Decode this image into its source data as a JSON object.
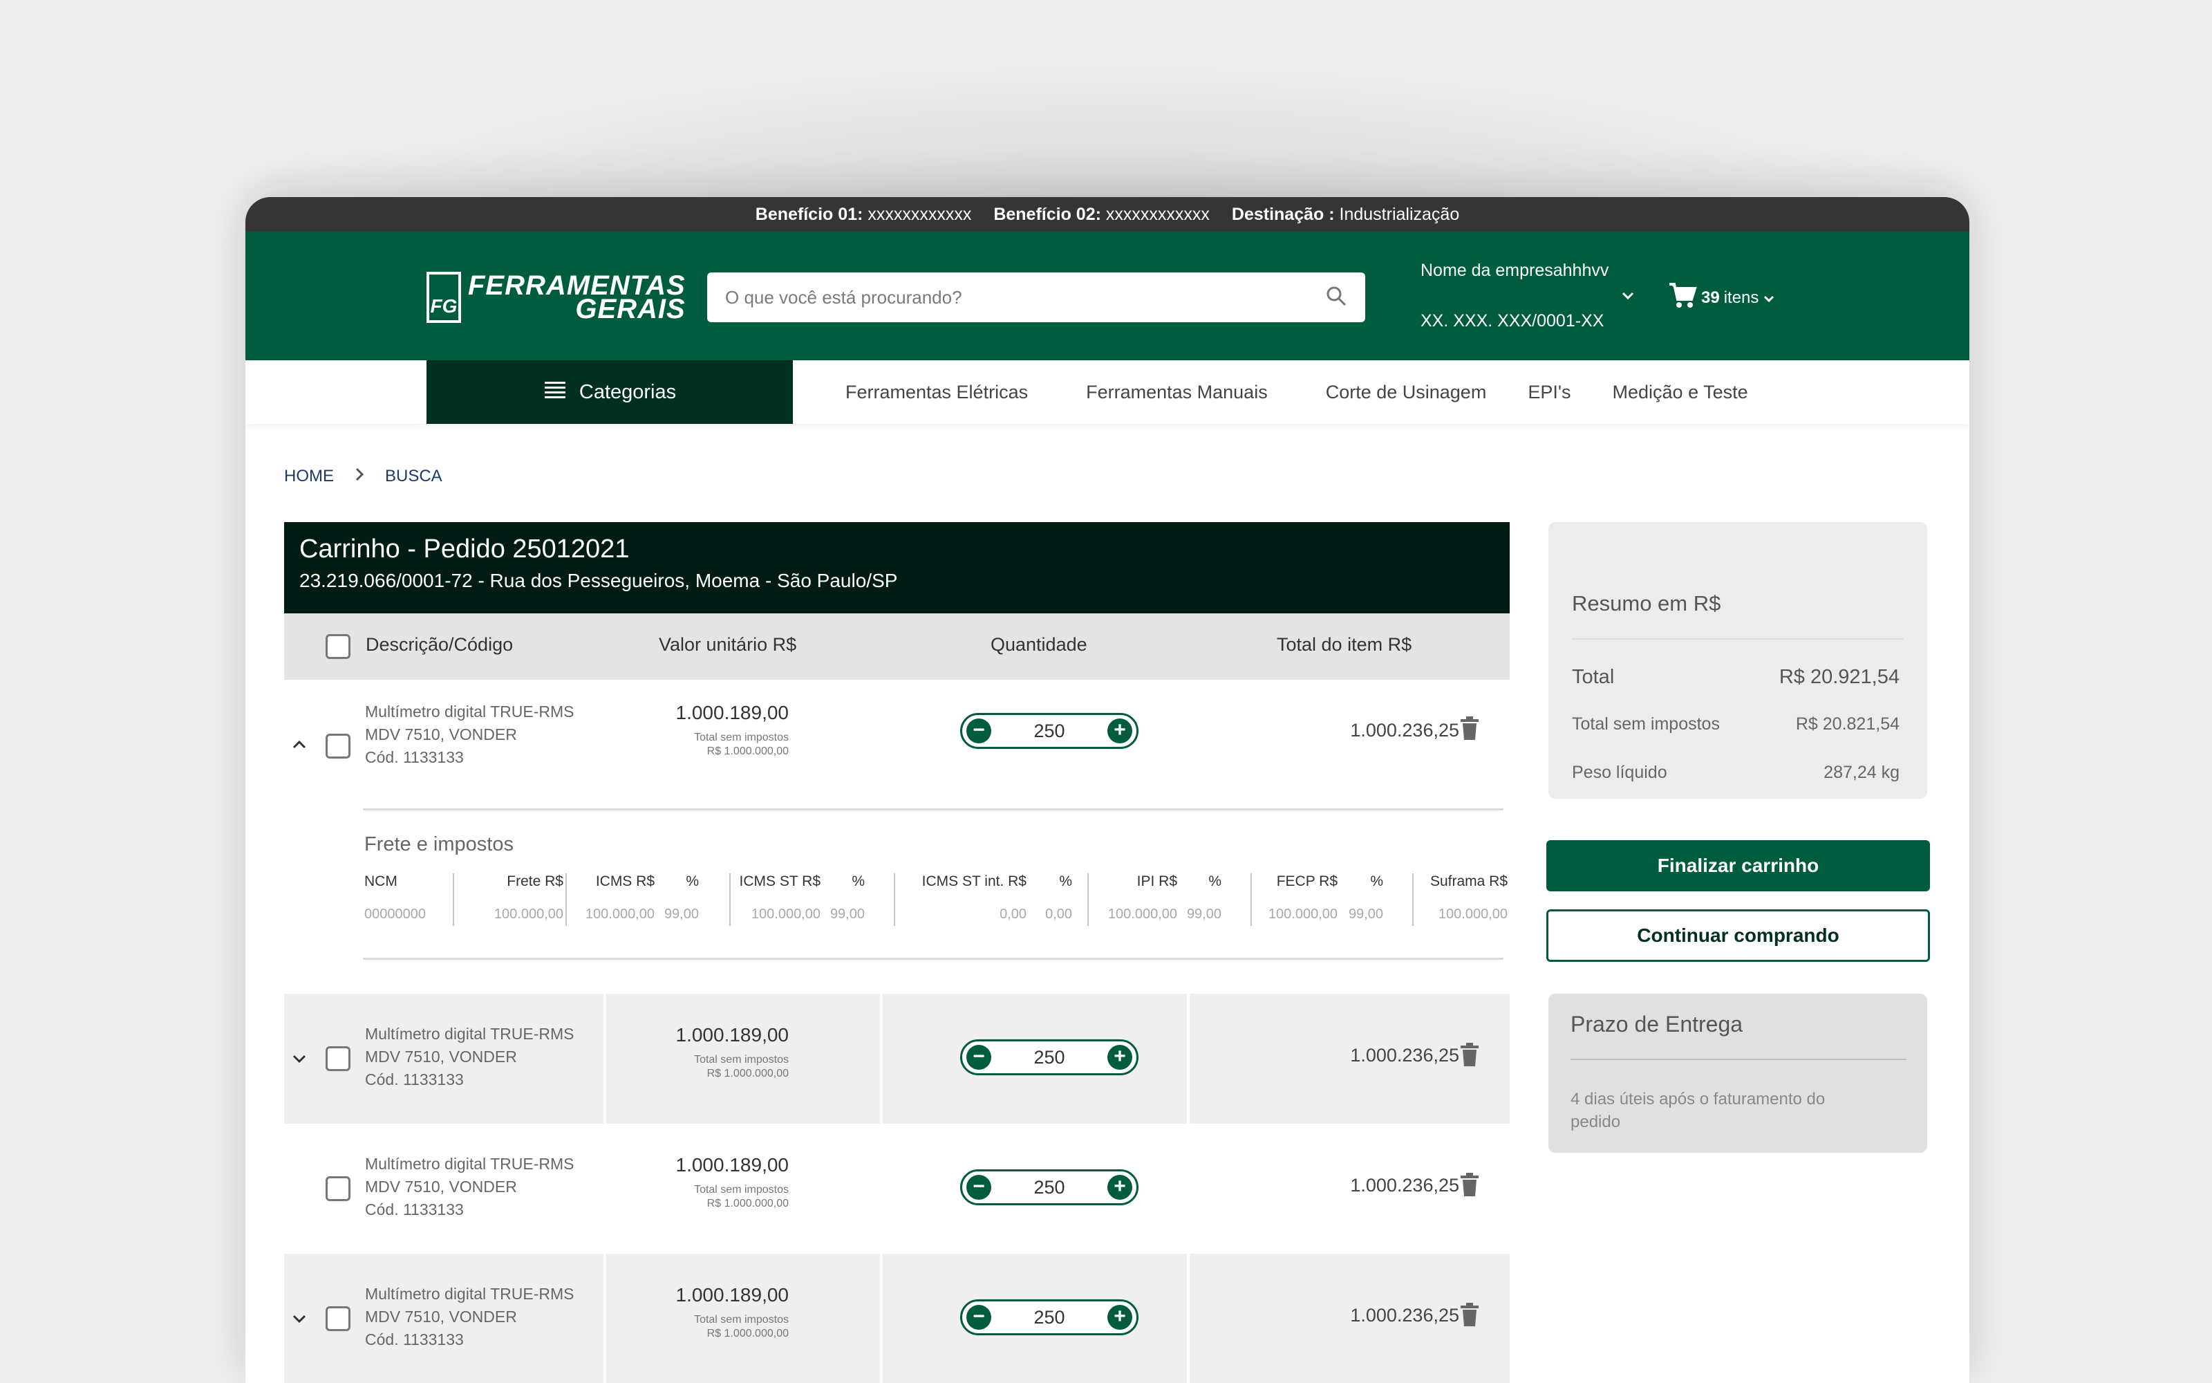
{
  "topbar": {
    "beneficio1_label": "Benefício 01:",
    "beneficio1_value": "xxxxxxxxxxxx",
    "beneficio2_label": "Benefício 02:",
    "beneficio2_value": "xxxxxxxxxxxx",
    "destinacao_label": "Destinação :",
    "destinacao_value": "Industrialização"
  },
  "header": {
    "logo_mark": "FG",
    "logo_line1": "FERRAMENTAS",
    "logo_line2": "GERAIS",
    "search_placeholder": "O que você está procurando?",
    "company_name": "Nome da empresahhhvv",
    "company_cnpj": "XX. XXX. XXX/0001-XX",
    "cart_count": "39",
    "cart_label": "itens"
  },
  "nav": {
    "categories": "Categorias",
    "links": [
      "Ferramentas Elétricas",
      "Ferramentas Manuais",
      "Corte de Usinagem",
      "EPI's",
      "Medição e Teste"
    ]
  },
  "breadcrumb": {
    "home": "HOME",
    "current": "BUSCA"
  },
  "cart": {
    "title": "Carrinho - Pedido 25012021",
    "subtitle": "23.219.066/0001-72 - Rua dos Pessegueiros, Moema - São Paulo/SP",
    "columns": {
      "description": "Descrição/Código",
      "unit_value": "Valor unitário R$",
      "quantity": "Quantidade",
      "total": "Total do item R$"
    },
    "items": [
      {
        "line1": "Multímetro digital TRUE-RMS",
        "line2": "MDV 7510, VONDER",
        "code": "Cód. 1133133",
        "unit": "1.000.189,00",
        "tax_label": "Total sem impostos",
        "tax_value": "R$ 1.000.000,00",
        "qty": "250",
        "total": "1.000.236,25"
      },
      {
        "line1": "Multímetro digital TRUE-RMS",
        "line2": "MDV 7510, VONDER",
        "code": "Cód. 1133133",
        "unit": "1.000.189,00",
        "tax_label": "Total sem impostos",
        "tax_value": "R$ 1.000.000,00",
        "qty": "250",
        "total": "1.000.236,25"
      },
      {
        "line1": "Multímetro digital TRUE-RMS",
        "line2": "MDV 7510, VONDER",
        "code": "Cód. 1133133",
        "unit": "1.000.189,00",
        "tax_label": "Total sem impostos",
        "tax_value": "R$ 1.000.000,00",
        "qty": "250",
        "total": "1.000.236,25"
      },
      {
        "line1": "Multímetro digital TRUE-RMS",
        "line2": "MDV 7510, VONDER",
        "code": "Cód. 1133133",
        "unit": "1.000.189,00",
        "tax_label": "Total sem impostos",
        "tax_value": "R$ 1.000.000,00",
        "qty": "250",
        "total": "1.000.236,25"
      }
    ],
    "freight": {
      "title": "Frete e impostos",
      "ncm_h": "NCM",
      "ncm_v": "00000000",
      "frete_h": "Frete R$",
      "frete_v": "100.000,00",
      "icms_h": "ICMS R$",
      "icms_pct_h": "%",
      "icms_v": "100.000,00",
      "icms_pct_v": "99,00",
      "icmsst_h": "ICMS ST R$",
      "icmsst_pct_h": "%",
      "icmsst_v": "100.000,00",
      "icmsst_pct_v": "99,00",
      "icmsstint_h": "ICMS ST  int. R$",
      "icmsstint_pct_h": "%",
      "icmsstint_v": "0,00",
      "icmsstint_pct_v": "0,00",
      "ipi_h": "IPI R$",
      "ipi_pct_h": "%",
      "ipi_v": "100.000,00",
      "ipi_pct_v": "99,00",
      "fecp_h": "FECP R$",
      "fecp_pct_h": "%",
      "fecp_v": "100.000,00",
      "fecp_pct_v": "99,00",
      "suframa_h": "Suframa R$",
      "suframa_v": "100.000,00"
    }
  },
  "summary": {
    "title": "Resumo em R$",
    "total_label": "Total",
    "total_value": "R$ 20.921,54",
    "notax_label": "Total sem impostos",
    "notax_value": "R$ 20.821,54",
    "weight_label": "Peso líquido",
    "weight_value": "287,24 kg"
  },
  "actions": {
    "finish": "Finalizar carrinho",
    "continue": "Continuar comprando"
  },
  "delivery": {
    "title": "Prazo de Entrega",
    "text": "4 dias úteis após o faturamento do pedido"
  },
  "colors": {
    "brand_green": "#005c3e",
    "dark_green": "#012f20",
    "topbar": "#353535"
  }
}
